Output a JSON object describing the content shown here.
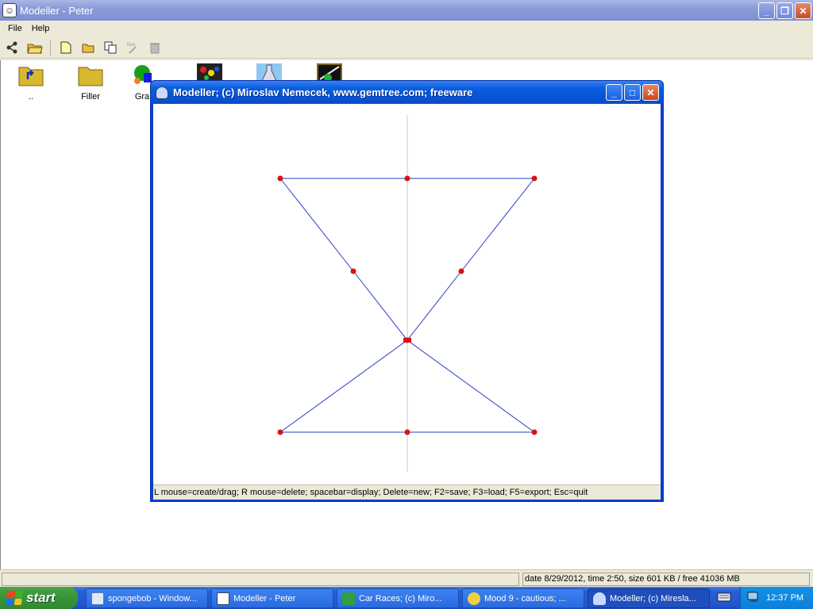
{
  "main_window": {
    "title": "Modeller - Peter",
    "menu": [
      {
        "label": "File"
      },
      {
        "label": "Help"
      }
    ],
    "files": [
      {
        "label": ".."
      },
      {
        "label": "Filler"
      },
      {
        "label": "Gra"
      }
    ],
    "status": "date 8/29/2012, time 2:50, size 601 KB / free 41036 MB"
  },
  "modeller": {
    "title": "Modeller;   (c) Miroslav Nemecek, www.gemtree.com;   freeware",
    "status": "L mouse=create/drag; R mouse=delete; spacebar=display; Delete=new; F2=save; F3=load; F5=export; Esc=quit"
  },
  "taskbar": {
    "start_label": "start",
    "tasks": [
      {
        "label": "spongebob - Window..."
      },
      {
        "label": "Modeller - Peter"
      },
      {
        "label": "Car Races;   (c) Miro..."
      },
      {
        "label": "Mood 9 - cautious;  ..."
      },
      {
        "label": "Modeller;   (c) Miresla..."
      }
    ],
    "clock": "12:37 PM"
  },
  "colors": {
    "line": "#2a3ccc",
    "point": "#dd1111",
    "axis": "#c8c8c8"
  }
}
